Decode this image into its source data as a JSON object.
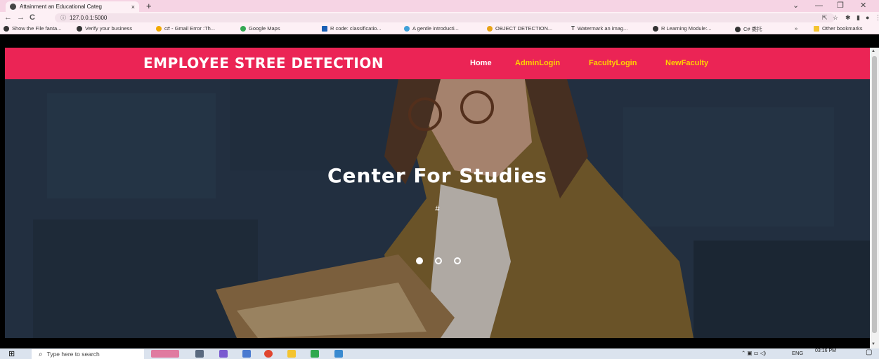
{
  "browser": {
    "tab_title": "Attainment an Educational Categ",
    "tab_close": "×",
    "new_tab": "+",
    "url": "127.0.0.1:5000",
    "window_controls": [
      "⌄",
      "—",
      "❐",
      "✕"
    ],
    "bookmarks": [
      {
        "label": "Show the File fanta...",
        "color": "#333333"
      },
      {
        "label": "Verify your business",
        "color": "#333333"
      },
      {
        "label": "c# - Gmail Error :Th...",
        "color": "#f2a900"
      },
      {
        "label": "Google Maps",
        "color": "#34a853"
      },
      {
        "label": "R code: classificatio...",
        "color": "#1a5fb4"
      },
      {
        "label": "A gentle introducti...",
        "color": "#3fa0d8"
      },
      {
        "label": "OBJECT DETECTION...",
        "color": "#e8a317"
      },
      {
        "label": "Watermark an imag...",
        "color": "#222222"
      },
      {
        "label": "R Learning Module:...",
        "color": "#333333"
      },
      {
        "label": "C# 委托",
        "color": "#333333"
      }
    ],
    "bookmarks_overflow": "»",
    "other_bookmarks": "Other bookmarks"
  },
  "site": {
    "brand": "EMPLOYEE STREE DETECTION",
    "nav": [
      "Home",
      "AdminLogin",
      "FacultyLogin",
      "NewFaculty"
    ],
    "active_index": 0,
    "accent_color": "#eb2455",
    "nav_color": "#ffd200"
  },
  "hero": {
    "title": "Center For Studies",
    "subtitle": "#",
    "slide_count": 3,
    "active_slide": 0
  },
  "taskbar": {
    "search_placeholder": "Type here to search",
    "tray_lang": "ENG",
    "time": "03:16 PM"
  }
}
